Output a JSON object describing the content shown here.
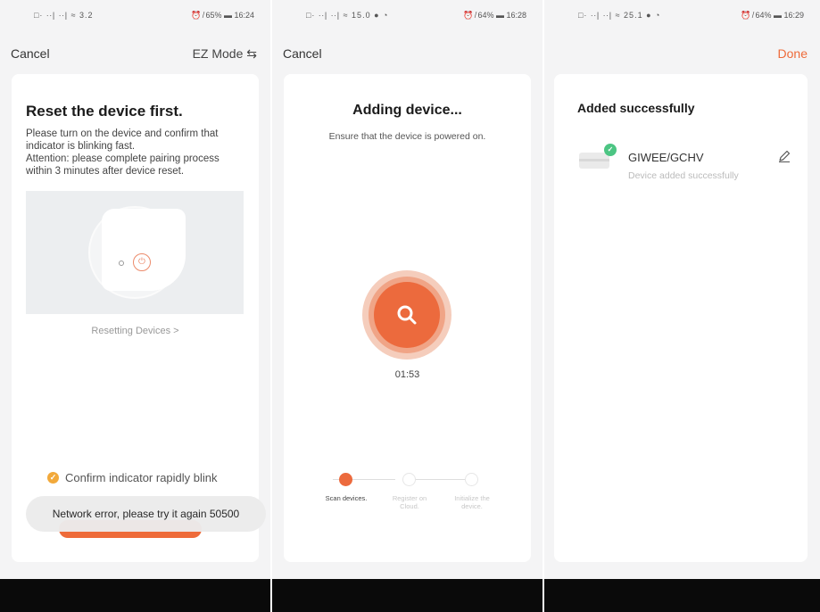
{
  "status_bars": [
    {
      "left": "□· ∙∙| ∙∙| ≈ 3.2",
      "right": "⏰ ̸ 65% ▬ 16:24"
    },
    {
      "left": "□· ∙∙| ∙∙| ≈ 15.0 ● ◔",
      "right": "⏰ ̸ 64% ▬ 16:28"
    },
    {
      "left": "□· ∙∙| ∙∙| ≈ 25.1 ● ◔",
      "right": "⏰ ̸ 64% ▬ 16:29"
    }
  ],
  "screen1": {
    "cancel": "Cancel",
    "mode": "EZ Mode ⇆",
    "title": "Reset the device first.",
    "description": "Please turn on the device and confirm that indicator is blinking fast.\nAttention: please complete pairing process within 3 minutes after device reset.",
    "reset_link": "Resetting Devices >",
    "confirm_label": "Confirm indicator rapidly blink",
    "toast": "Network error, please try it again 50500"
  },
  "screen2": {
    "cancel": "Cancel",
    "title": "Adding device...",
    "subtitle": "Ensure that the device is powered on.",
    "timer": "01:53",
    "steps": [
      {
        "label": "Scan devices.",
        "active": true
      },
      {
        "label": "Register on Cloud.",
        "active": false
      },
      {
        "label": "Initialize the device.",
        "active": false
      }
    ]
  },
  "screen3": {
    "done": "Done",
    "title": "Added successfully",
    "device_name": "GIWEE/GCHV",
    "device_status": "Device added successfully"
  },
  "colors": {
    "accent": "#ee6b3a",
    "success": "#4cc583",
    "warning": "#f2a93b"
  }
}
